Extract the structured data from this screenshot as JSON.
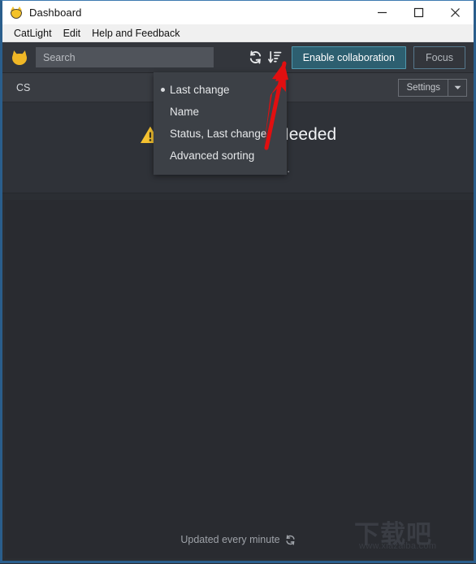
{
  "window": {
    "title": "Dashboard",
    "logo_icon": "cat-icon",
    "controls": {
      "minimize": "minimize-icon",
      "maximize": "maximize-icon",
      "close": "close-icon"
    },
    "border_color": "#2a5e8c"
  },
  "menubar": {
    "items": [
      {
        "label": "CatLight"
      },
      {
        "label": "Edit"
      },
      {
        "label": "Help and Feedback"
      }
    ]
  },
  "toolbar": {
    "logo_icon": "cat-logo-icon",
    "search": {
      "placeholder": "Search",
      "value": ""
    },
    "refresh_icon": "refresh-icon",
    "sort_icon": "sort-descending-icon",
    "enable_collaboration_label": "Enable collaboration",
    "focus_label": "Focus",
    "primary_button_color": "#2d5f70",
    "primary_border_color": "#4f98ae"
  },
  "project_row": {
    "name": "CS",
    "settings_label": "Settings",
    "settings_caret_icon": "chevron-down-icon"
  },
  "status": {
    "warning_icon": "warning-triangle-icon",
    "warning_color": "#f5c230",
    "title": "Configuration Needed",
    "subtitle": "Configuration needed."
  },
  "sort_menu": {
    "visible": true,
    "selected": "Last change",
    "items": [
      {
        "label": "Last change",
        "selected": true
      },
      {
        "label": "Name",
        "selected": false
      },
      {
        "label": "Status, Last change",
        "selected": false
      },
      {
        "label": "Advanced sorting",
        "selected": false
      }
    ]
  },
  "footer": {
    "text": "Updated every minute",
    "refresh_icon": "refresh-icon"
  },
  "annotation": {
    "type": "arrow",
    "color": "#e10f10",
    "points_to": "sort-descending-icon"
  },
  "watermark": {
    "glyphs": "下载吧",
    "url": "www.xiazaiba.com"
  }
}
